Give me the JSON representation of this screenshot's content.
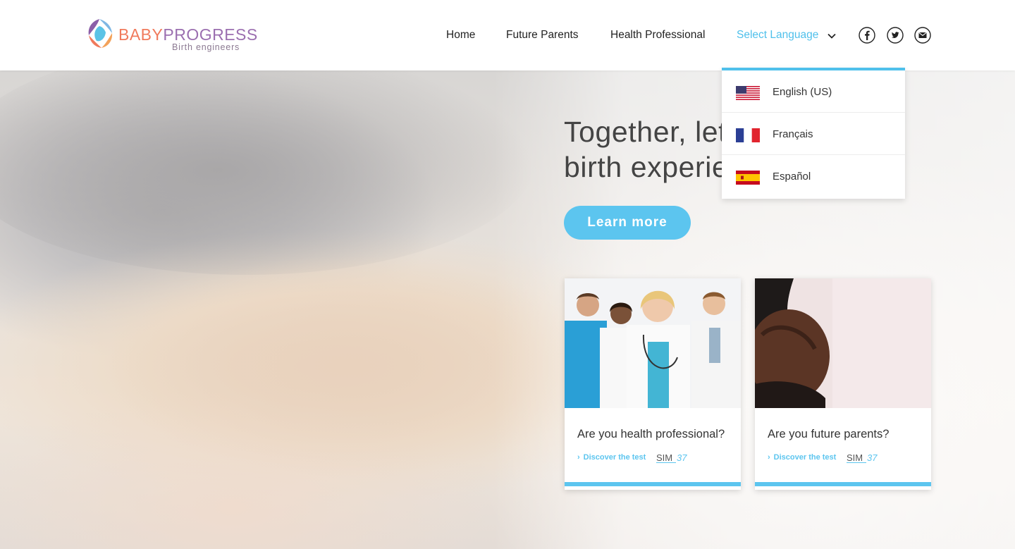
{
  "brand": {
    "name_part1": "BABY",
    "name_part2": "PROGRESS",
    "tagline": "Birth engineers"
  },
  "nav": {
    "items": [
      "Home",
      "Future Parents",
      "Health Professional"
    ],
    "language_label": "Select Language",
    "social": [
      "facebook-icon",
      "twitter-icon",
      "email-icon"
    ]
  },
  "language_menu": {
    "options": [
      {
        "label": "English (US)",
        "flag": "us-flag-icon"
      },
      {
        "label": "Français",
        "flag": "france-flag-icon"
      },
      {
        "label": "Español",
        "flag": "spain-flag-icon"
      }
    ]
  },
  "hero": {
    "headline_line1": "Together, let",
    "headline_line2": "birth experie",
    "cta_label": "Learn more"
  },
  "cards": [
    {
      "title": "Are you health professional?",
      "link": "Discover the test",
      "badge": "SIM37"
    },
    {
      "title": "Are you future parents?",
      "link": "Discover the test",
      "badge": "SIM37"
    }
  ],
  "colors": {
    "accent": "#5cc5ef",
    "brand_orange": "#f07a5c",
    "brand_purple": "#9b6fb0"
  }
}
